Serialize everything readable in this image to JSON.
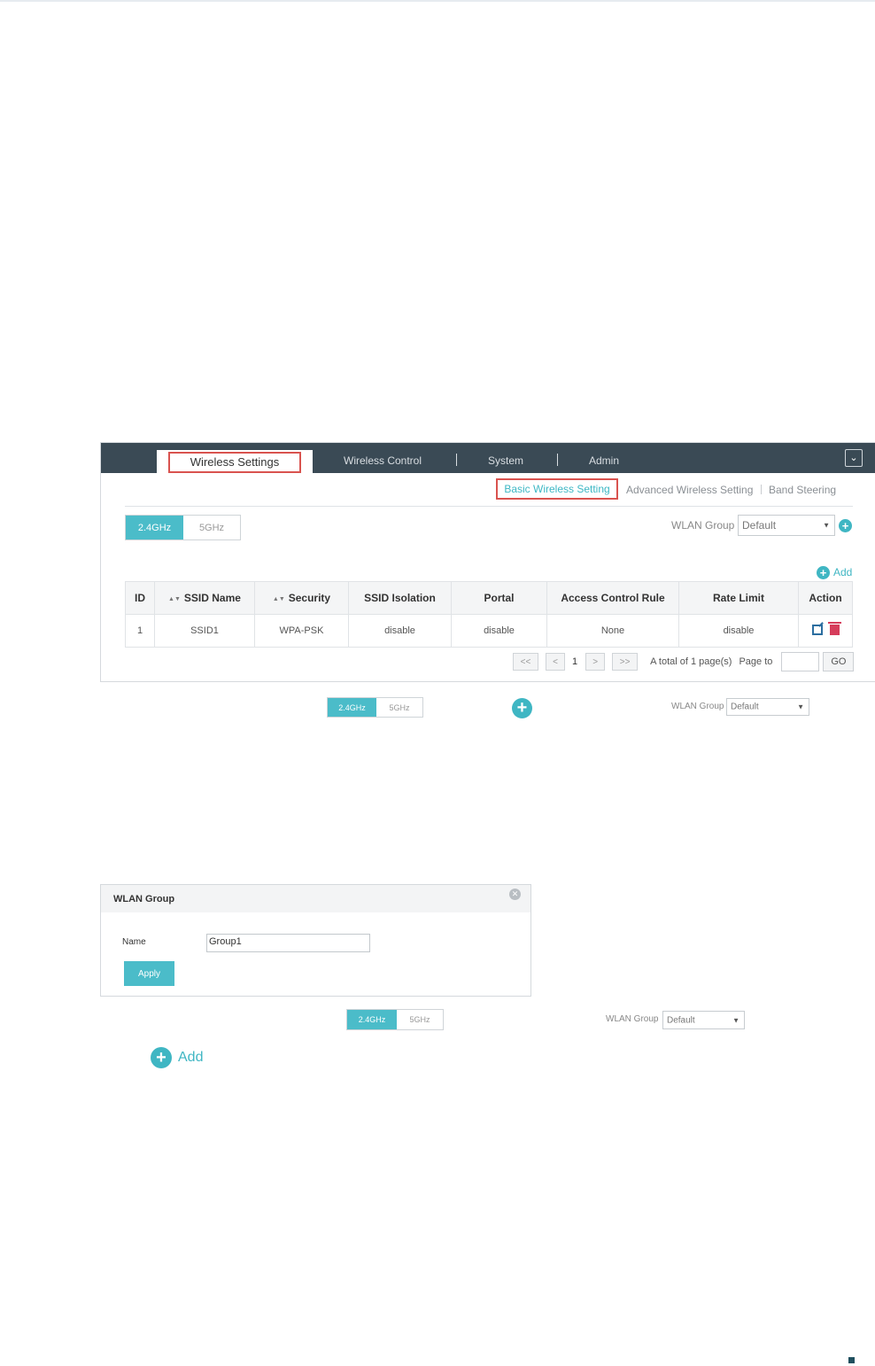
{
  "nav": {
    "tabs": [
      "Wireless Settings",
      "Wireless Control",
      "System",
      "Admin"
    ],
    "collapse_glyph": "⌄"
  },
  "subnav": {
    "items": [
      "Basic Wireless Setting",
      "Advanced Wireless Setting",
      "Band Steering"
    ]
  },
  "bands": {
    "b24": "2.4GHz",
    "b5": "5GHz"
  },
  "wlan_group": {
    "label": "WLAN Group",
    "value": "Default"
  },
  "add_label": "Add",
  "table": {
    "headers": [
      "ID",
      "SSID Name",
      "Security",
      "SSID Isolation",
      "Portal",
      "Access Control Rule",
      "Rate Limit",
      "Action"
    ],
    "rows": [
      {
        "id": "1",
        "ssid": "SSID1",
        "security": "WPA-PSK",
        "isolation": "disable",
        "portal": "disable",
        "acl": "None",
        "rate": "disable"
      }
    ]
  },
  "pager": {
    "first": "<<",
    "prev": "<",
    "page": "1",
    "next": ">",
    "last": ">>",
    "total": "A total of 1 page(s)",
    "page_to": "Page to",
    "go": "GO"
  },
  "dialog": {
    "title": "WLAN Group",
    "name_label": "Name",
    "name_value": "Group1",
    "apply": "Apply"
  },
  "colors": {
    "accent": "#4bbcc9",
    "nav_bg": "#3a4a55",
    "highlight": "#d9534f",
    "delete": "#d63d5b",
    "edit": "#2c6ea0"
  },
  "icons": [
    "chevron-down-icon",
    "plus-circle-icon",
    "edit-icon",
    "delete-icon",
    "close-icon",
    "sort-icon"
  ]
}
